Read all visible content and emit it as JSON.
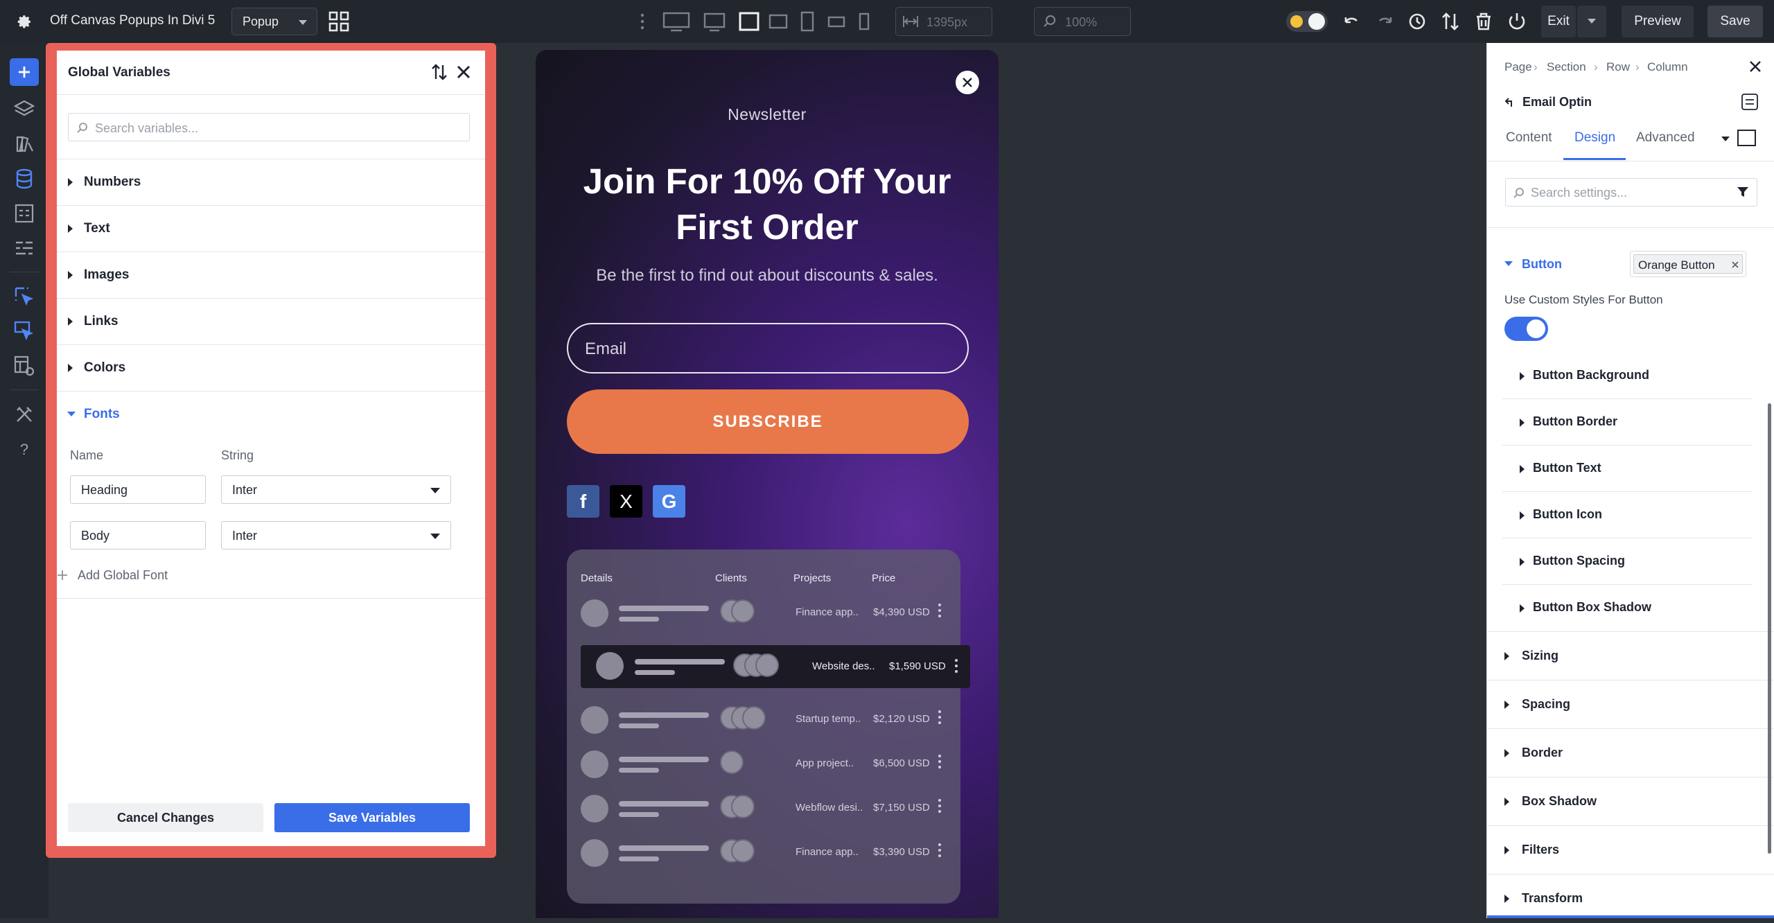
{
  "topbar": {
    "title": "Off Canvas Popups In Divi 5",
    "layout_select": "Popup",
    "width_value": "1395px",
    "zoom_value": "100%",
    "exit_label": "Exit",
    "preview_label": "Preview",
    "save_label": "Save"
  },
  "global_variables": {
    "title": "Global Variables",
    "search_placeholder": "Search variables...",
    "sections": [
      "Numbers",
      "Text",
      "Images",
      "Links",
      "Colors"
    ],
    "fonts": {
      "label": "Fonts",
      "col_name": "Name",
      "col_string": "String",
      "rows": [
        {
          "name": "Heading",
          "value": "Inter"
        },
        {
          "name": "Body",
          "value": "Inter"
        }
      ],
      "add_label": "Add Global Font"
    },
    "cancel_label": "Cancel Changes",
    "save_label": "Save Variables"
  },
  "popup": {
    "eyebrow": "Newsletter",
    "heading_line1": "Join For 10% Off Your",
    "heading_line2": "First Order",
    "subtitle": "Be the first to find out about discounts & sales.",
    "email_placeholder": "Email",
    "button_label": "SUBSCRIBE",
    "social": [
      "f",
      "X",
      "G"
    ],
    "table": {
      "headers": [
        "Details",
        "Clients",
        "Projects",
        "Price"
      ],
      "rows": [
        {
          "project": "Finance app..",
          "price": "$4,390 USD"
        },
        {
          "project": "Website des..",
          "price": "$1,590 USD"
        },
        {
          "project": "Startup temp..",
          "price": "$2,120 USD"
        },
        {
          "project": "App project..",
          "price": "$6,500 USD"
        },
        {
          "project": "Webflow desi..",
          "price": "$7,150 USD"
        },
        {
          "project": "Finance app..",
          "price": "$3,390 USD"
        }
      ]
    }
  },
  "settings": {
    "breadcrumb": [
      "Page",
      "Section",
      "Row",
      "Column"
    ],
    "module_name": "Email Optin",
    "tabs": [
      "Content",
      "Design",
      "Advanced"
    ],
    "active_tab": "Design",
    "search_placeholder": "Search settings...",
    "button_group": {
      "label": "Button",
      "preset": "Orange Button",
      "toggle_label": "Use Custom Styles For Button",
      "toggle_on": true,
      "subsections": [
        "Button Background",
        "Button Border",
        "Button Text",
        "Button Icon",
        "Button Spacing",
        "Button Box Shadow"
      ]
    },
    "sections": [
      "Sizing",
      "Spacing",
      "Border",
      "Box Shadow",
      "Filters",
      "Transform"
    ]
  },
  "colors": {
    "accent": "#3a6ee8",
    "highlight_frame": "#e9625a",
    "subscribe": "#e8784a",
    "topbar_bg": "#22262d"
  }
}
